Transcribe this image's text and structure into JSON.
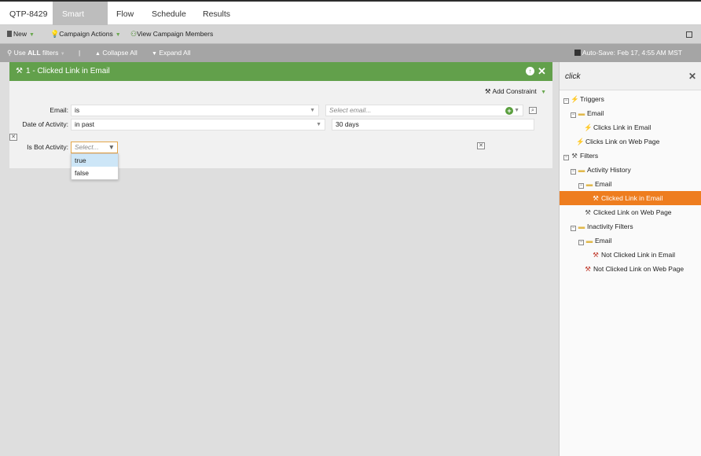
{
  "tabs": [
    {
      "label": "QTP-8429",
      "active": false
    },
    {
      "label": "Smart List",
      "active": true
    },
    {
      "label": "Flow",
      "active": false
    },
    {
      "label": "Schedule",
      "active": false
    },
    {
      "label": "Results",
      "active": false
    }
  ],
  "toolbar": {
    "new_label": "New",
    "campaign_actions_label": "Campaign Actions",
    "view_members_label": "View Campaign Members"
  },
  "filterbar": {
    "use_label": "Use",
    "all_label": "ALL",
    "filters_label": "filters",
    "separator": "|",
    "collapse_label": "Collapse All",
    "expand_label": "Expand All",
    "autosave": "Auto-Save: Feb 17, 4:55 AM MST"
  },
  "filter": {
    "title": "1 - Clicked Link in Email",
    "add_constraint": "Add Constraint",
    "rows": {
      "email_label": "Email:",
      "email_operator": "is",
      "email_placeholder": "Select email...",
      "date_label": "Date of Activity:",
      "date_operator": "in past",
      "date_value": "30 days",
      "bot_label": "Is Bot Activity:",
      "bot_placeholder": "Select..."
    },
    "bot_options": [
      "true",
      "false"
    ]
  },
  "right_panel": {
    "search_value": "click",
    "tree": {
      "triggers": "Triggers",
      "triggers_email": "Email",
      "clicks_link_in_email": "Clicks Link in Email",
      "clicks_link_on_web_page": "Clicks Link on Web Page",
      "filters": "Filters",
      "activity_history": "Activity History",
      "activity_email": "Email",
      "clicked_link_in_email": "Clicked Link in Email",
      "clicked_link_on_web_page": "Clicked Link on Web Page",
      "inactivity_filters": "Inactivity Filters",
      "inactivity_email": "Email",
      "not_clicked_link_in_email": "Not Clicked Link in Email",
      "not_clicked_link_on_web_page": "Not Clicked Link on Web Page"
    }
  },
  "colors": {
    "filter_header": "#62a04b",
    "selected_tree_item": "#ee7d1f",
    "active_tab": "#bdbdbd"
  }
}
